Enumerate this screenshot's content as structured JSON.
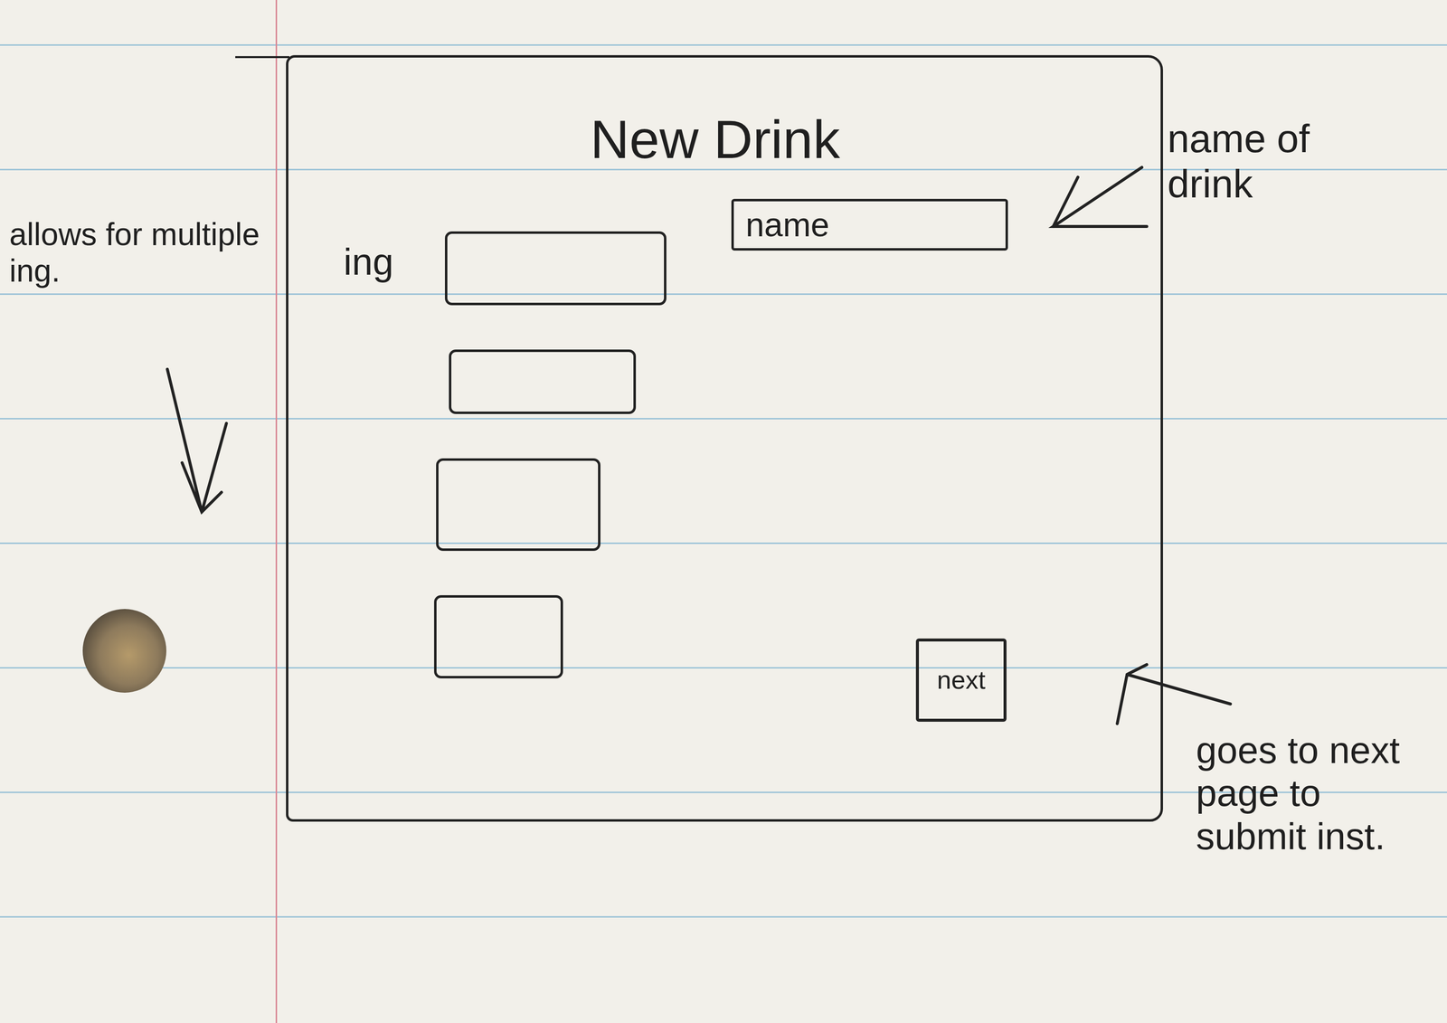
{
  "sketch": {
    "title": "New Drink",
    "name_field": {
      "text": "name"
    },
    "ingredients": {
      "label": "ing",
      "fields": [
        {
          "value": ""
        },
        {
          "value": ""
        },
        {
          "value": ""
        },
        {
          "value": ""
        }
      ]
    },
    "button": {
      "label": "next"
    }
  },
  "notes": {
    "ingredients": "allows for multiple ing.",
    "name": "name of drink",
    "next": "goes to next page to submit inst."
  }
}
